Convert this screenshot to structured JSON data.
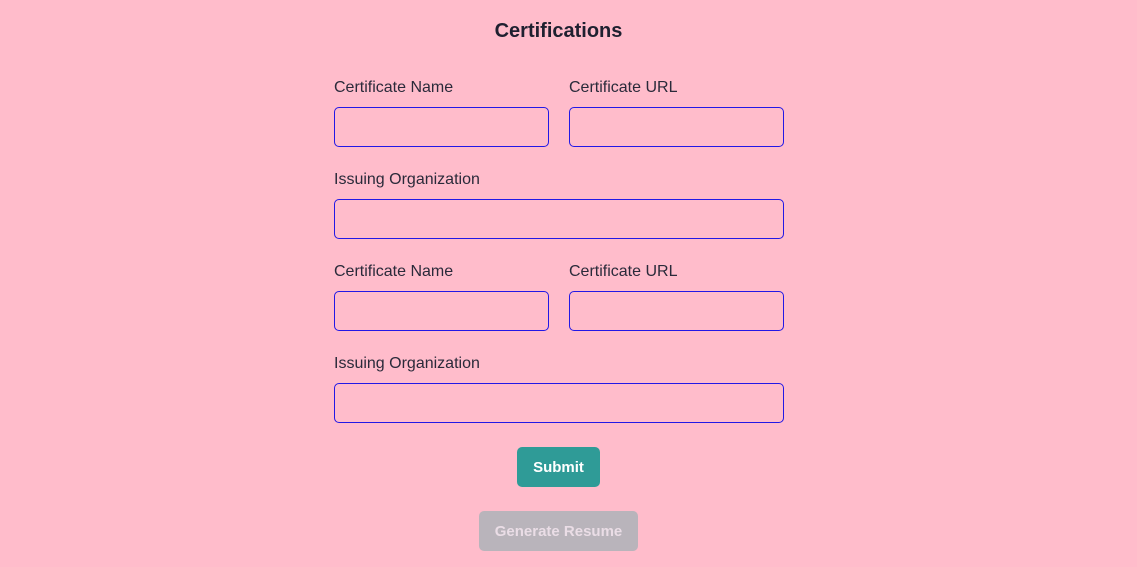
{
  "section": {
    "title": "Certifications"
  },
  "certifications": [
    {
      "name_label": "Certificate Name",
      "name_value": "",
      "url_label": "Certificate URL",
      "url_value": "",
      "org_label": "Issuing Organization",
      "org_value": ""
    },
    {
      "name_label": "Certificate Name",
      "name_value": "",
      "url_label": "Certificate URL",
      "url_value": "",
      "org_label": "Issuing Organization",
      "org_value": ""
    }
  ],
  "actions": {
    "submit_label": "Submit",
    "generate_label": "Generate Resume",
    "generate_disabled": true
  },
  "colors": {
    "background": "#ffbccb",
    "input_border": "#2218e6",
    "submit_bg": "#2f9b97",
    "generate_bg": "#b9b4bb"
  }
}
